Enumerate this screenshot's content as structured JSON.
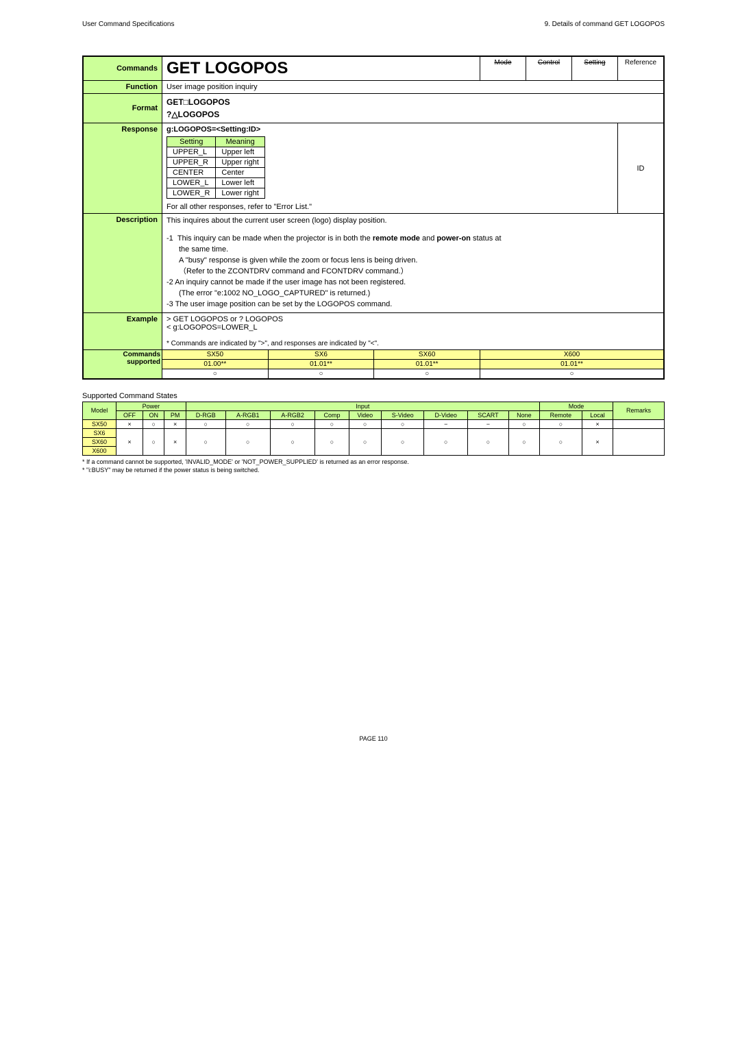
{
  "header": {
    "left": "User Command Specifications",
    "right": "9. Details of command  GET LOGOPOS"
  },
  "commands_label": "Commands",
  "title": "GET LOGOPOS",
  "tags": {
    "mode": "Mode",
    "control": "Control",
    "setting": "Setting",
    "reference": "Reference"
  },
  "function_label": "Function",
  "function_text": "User image position inquiry",
  "format_label": "Format",
  "format_line1": "GET□LOGOPOS",
  "format_line2": "?△LOGOPOS",
  "response_label": "Response",
  "response_header": "g:LOGOPOS=<Setting:ID>",
  "response_table": {
    "cols": [
      "Setting",
      "Meaning"
    ],
    "rows": [
      [
        "UPPER_L",
        "Upper left"
      ],
      [
        "UPPER_R",
        "Upper right"
      ],
      [
        "CENTER",
        "Center"
      ],
      [
        "LOWER_L",
        "Lower left"
      ],
      [
        "LOWER_R",
        "Lower right"
      ]
    ]
  },
  "response_footer": "For all other responses, refer to \"Error List.\"",
  "response_right": "ID",
  "description_label": "Description",
  "description_main": "This inquires about the current user screen (logo) display position.",
  "description_lines": [
    "-1  This inquiry can be made when the projector is in both the remote mode and power-on status at",
    "    the same time.",
    "    A \"busy\" response is given while the zoom or focus lens is being driven.",
    "    （Refer to the ZCONTDRV command and FCONTDRV command.）",
    "-2  An inquiry cannot be made if the user image has not been registered.",
    "    (The error \"e:1002 NO_LOGO_CAPTURED\" is returned.)",
    "-3  The user image position can be set by the LOGOPOS command."
  ],
  "desc_bold1": "remote mode",
  "desc_bold2": "power-on",
  "example_label": "Example",
  "example_line1": "> GET LOGOPOS or ? LOGOPOS",
  "example_line2": "< g:LOGOPOS=LOWER_L",
  "example_note": "* Commands are indicated by \">\", and responses are indicated by \"<\".",
  "supported_label1": "Commands",
  "supported_label2": "supported",
  "supported": {
    "models": [
      "SX50",
      "SX6",
      "SX60",
      "X600"
    ],
    "versions": [
      "01.00**",
      "01.01**",
      "01.01**",
      "01.01**"
    ],
    "marks": [
      "○",
      "○",
      "○",
      "○"
    ]
  },
  "scs_title": "Supported Command States",
  "scs_headers": {
    "model": "Model",
    "power": "Power",
    "input": "Input",
    "mode": "Mode",
    "remarks": "Remarks",
    "power_sub": [
      "OFF",
      "ON",
      "PM"
    ],
    "input_sub": [
      "D-RGB",
      "A-RGB1",
      "A-RGB2",
      "Comp",
      "Video",
      "S-Video",
      "D-Video",
      "SCART",
      "None"
    ],
    "mode_sub": [
      "Remote",
      "Local"
    ]
  },
  "scs_rows": [
    {
      "model": "SX50",
      "cells": [
        "×",
        "○",
        "×",
        "○",
        "○",
        "○",
        "○",
        "○",
        "○",
        "−",
        "−",
        "○",
        "○",
        "×"
      ]
    },
    {
      "model": "SX6",
      "cells": [
        "×",
        "○",
        "×",
        "○",
        "○",
        "○",
        "○",
        "○",
        "○",
        "○",
        "○",
        "○",
        "○",
        "×"
      ]
    },
    {
      "model": "SX60",
      "cells": [
        "",
        "",
        "",
        "",
        "",
        "",
        "",
        "",
        "",
        "",
        "",
        "",
        "",
        ""
      ]
    },
    {
      "model": "X600",
      "cells": [
        "",
        "",
        "",
        "",
        "",
        "",
        "",
        "",
        "",
        "",
        "",
        "",
        "",
        ""
      ]
    }
  ],
  "notes": [
    "* If a command cannot be supported, 'INVALID_MODE' or 'NOT_POWER_SUPPLIED' is returned as an error response.",
    "* \"i:BUSY\" may be returned if the power status is being switched."
  ],
  "page_num": "PAGE 110"
}
